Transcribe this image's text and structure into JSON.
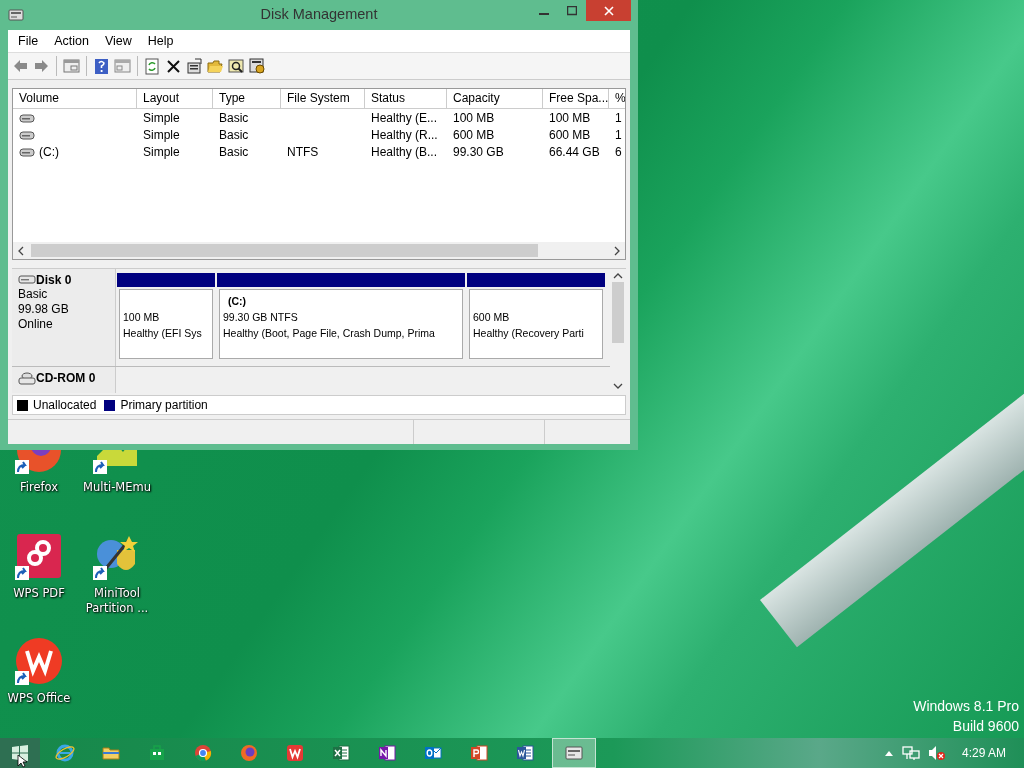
{
  "window": {
    "title": "Disk Management",
    "menu": [
      "File",
      "Action",
      "View",
      "Help"
    ],
    "volumes": {
      "columns": [
        "Volume",
        "Layout",
        "Type",
        "File System",
        "Status",
        "Capacity",
        "Free Spa...",
        "%"
      ],
      "rows": [
        {
          "cells": [
            "",
            "Simple",
            "Basic",
            "",
            "Healthy (E...",
            "100 MB",
            "100 MB",
            "1"
          ]
        },
        {
          "cells": [
            "",
            "Simple",
            "Basic",
            "",
            "Healthy (R...",
            "600 MB",
            "600 MB",
            "1"
          ]
        },
        {
          "cells": [
            "(C:)",
            "Simple",
            "Basic",
            "NTFS",
            "Healthy (B...",
            "99.30 GB",
            "66.44 GB",
            "6"
          ]
        }
      ]
    },
    "disks": [
      {
        "kind": "disk",
        "name": "Disk 0",
        "lines": [
          "Basic",
          "99.98 GB",
          "Online"
        ],
        "partitions": [
          {
            "kind": "primary",
            "size": "100 MB",
            "status": "Healthy (EFI Sys"
          },
          {
            "kind": "primary",
            "label": "(C:)",
            "size": "99.30 GB NTFS",
            "status": "Healthy (Boot, Page File, Crash Dump, Prima"
          },
          {
            "kind": "primary",
            "size": "600 MB",
            "status": "Healthy (Recovery Parti"
          }
        ]
      },
      {
        "kind": "cdrom",
        "name": "CD-ROM 0"
      }
    ],
    "legend": [
      {
        "label": "Unallocated",
        "color": "#000000"
      },
      {
        "label": "Primary partition",
        "color": "#00007f"
      }
    ]
  },
  "desktop_icons": [
    {
      "kind": "firefox",
      "label": "Firefox"
    },
    {
      "kind": "memu",
      "label": "Multi-MEmu"
    },
    {
      "kind": "wpspdf",
      "label": "WPS PDF"
    },
    {
      "kind": "minitool",
      "label": "MiniTool Partition ..."
    },
    {
      "kind": "wpsoffice",
      "label": "WPS Office"
    }
  ],
  "os_watermark": [
    "Windows 8.1 Pro",
    "Build 9600"
  ],
  "taskbar": {
    "items": [
      {
        "kind": "ie",
        "selected": false
      },
      {
        "kind": "explorer",
        "selected": false
      },
      {
        "kind": "store",
        "selected": false
      },
      {
        "kind": "chrome",
        "selected": false
      },
      {
        "kind": "firefox",
        "selected": false
      },
      {
        "kind": "wps",
        "selected": false
      },
      {
        "kind": "excel",
        "selected": false
      },
      {
        "kind": "onenote",
        "selected": false
      },
      {
        "kind": "outlook",
        "selected": false
      },
      {
        "kind": "powerpoint",
        "selected": false
      },
      {
        "kind": "word",
        "selected": false
      },
      {
        "kind": "diskmgmt",
        "selected": true
      }
    ],
    "clock": "4:29 AM"
  }
}
